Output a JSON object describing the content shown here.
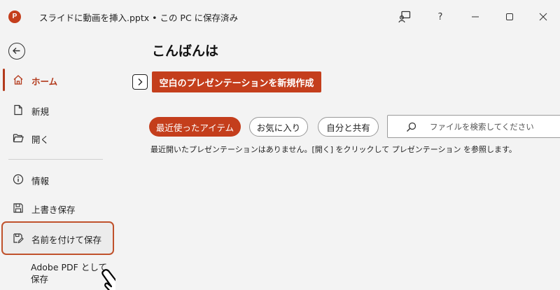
{
  "window": {
    "app_logo_letter": "P",
    "title": "スライドに動画を挿入.pptx • この PC に保存済み",
    "help_label": "?"
  },
  "sidebar": {
    "items": [
      {
        "label": "ホーム",
        "icon": "home-icon"
      },
      {
        "label": "新規",
        "icon": "new-document-icon"
      },
      {
        "label": "開く",
        "icon": "open-folder-icon"
      },
      {
        "label": "情報",
        "icon": "info-icon"
      },
      {
        "label": "上書き保存",
        "icon": "save-icon"
      },
      {
        "label": "名前を付けて保存",
        "icon": "save-as-icon"
      }
    ],
    "export_pdf_line1": "Adobe PDF として",
    "export_pdf_line2": "保存"
  },
  "main": {
    "greeting": "こんばんは",
    "new_blank_label": "空白のプレゼンテーションを新規作成",
    "tabs": [
      "最近使ったアイテム",
      "お気に入り",
      "自分と共有"
    ],
    "search_placeholder": "ファイルを検索してください",
    "empty_message": "最近開いたプレゼンテーションはありません。[開く] をクリックして プレゼンテーション を参照します。"
  },
  "colors": {
    "accent": "#c43e1c",
    "highlight_border": "#c0522c"
  }
}
